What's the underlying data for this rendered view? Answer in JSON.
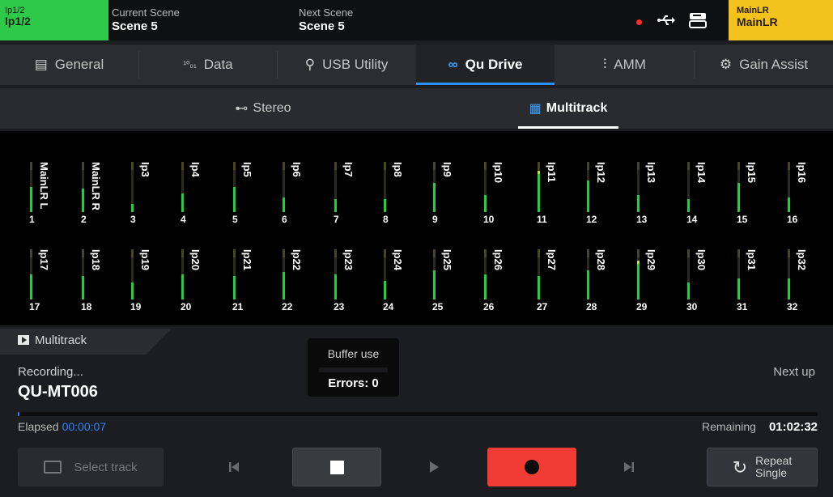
{
  "top": {
    "channel_line1": "Ip1/2",
    "channel_line2": "Ip1/2",
    "current_scene_label": "Current Scene",
    "current_scene_value": "Scene 5",
    "next_scene_label": "Next Scene",
    "next_scene_value": "Scene 5",
    "mix_line1": "MainLR",
    "mix_line2": "MainLR",
    "icons": [
      "record-indicator",
      "usb-icon",
      "drive-icon"
    ]
  },
  "tabs": [
    {
      "label": "General",
      "icon": "▤"
    },
    {
      "label": "Data",
      "icon": "¹⁰₀₁"
    },
    {
      "label": "USB Utility",
      "icon": "⚲"
    },
    {
      "label": "Qu Drive",
      "icon": "∞"
    },
    {
      "label": "AMM",
      "icon": "⫶"
    },
    {
      "label": "Gain Assist",
      "icon": "⚙"
    }
  ],
  "active_tab": "Qu Drive",
  "subtabs": [
    {
      "label": "Stereo",
      "icon": "⊷"
    },
    {
      "label": "Multitrack",
      "icon": "▦"
    }
  ],
  "active_subtab": "Multitrack",
  "channels": [
    {
      "num": "1",
      "name": "MainLR L",
      "level": 0.6
    },
    {
      "num": "2",
      "name": "MainLR R",
      "level": 0.55
    },
    {
      "num": "3",
      "name": "Ip3",
      "level": 0.2
    },
    {
      "num": "4",
      "name": "Ip4",
      "level": 0.45
    },
    {
      "num": "5",
      "name": "Ip5",
      "level": 0.6
    },
    {
      "num": "6",
      "name": "Ip6",
      "level": 0.35
    },
    {
      "num": "7",
      "name": "Ip7",
      "level": 0.3
    },
    {
      "num": "8",
      "name": "Ip8",
      "level": 0.3
    },
    {
      "num": "9",
      "name": "Ip9",
      "level": 0.7
    },
    {
      "num": "10",
      "name": "Ip10",
      "level": 0.4
    },
    {
      "num": "11",
      "name": "Ip11",
      "level": 0.9
    },
    {
      "num": "12",
      "name": "Ip12",
      "level": 0.75
    },
    {
      "num": "13",
      "name": "Ip13",
      "level": 0.4
    },
    {
      "num": "14",
      "name": "Ip14",
      "level": 0.3
    },
    {
      "num": "15",
      "name": "Ip15",
      "level": 0.7
    },
    {
      "num": "16",
      "name": "Ip16",
      "level": 0.35
    },
    {
      "num": "17",
      "name": "Ip17",
      "level": 0.6
    },
    {
      "num": "18",
      "name": "Ip18",
      "level": 0.55
    },
    {
      "num": "19",
      "name": "Ip19",
      "level": 0.4
    },
    {
      "num": "20",
      "name": "Ip20",
      "level": 0.6
    },
    {
      "num": "21",
      "name": "Ip21",
      "level": 0.55
    },
    {
      "num": "22",
      "name": "Ip22",
      "level": 0.65
    },
    {
      "num": "23",
      "name": "Ip23",
      "level": 0.6
    },
    {
      "num": "24",
      "name": "Ip24",
      "level": 0.45
    },
    {
      "num": "25",
      "name": "Ip25",
      "level": 0.7
    },
    {
      "num": "26",
      "name": "Ip26",
      "level": 0.6
    },
    {
      "num": "27",
      "name": "Ip27",
      "level": 0.55
    },
    {
      "num": "28",
      "name": "Ip28",
      "level": 0.7
    },
    {
      "num": "29",
      "name": "Ip29",
      "level": 0.85
    },
    {
      "num": "30",
      "name": "Ip30",
      "level": 0.4
    },
    {
      "num": "31",
      "name": "Ip31",
      "level": 0.5
    },
    {
      "num": "32",
      "name": "Ip32",
      "level": 0.5
    }
  ],
  "player": {
    "section_label": "Multitrack",
    "status": "Recording...",
    "track": "QU-MT006",
    "buffer_label": "Buffer use",
    "errors": "Errors: 0",
    "next_up": "Next up",
    "elapsed_label": "Elapsed",
    "elapsed_value": "00:00:07",
    "remaining_label": "Remaining",
    "remaining_value": "01:02:32",
    "progress": 0.002
  },
  "transport": {
    "select_track": "Select track",
    "repeat_line1": "Repeat",
    "repeat_line2": "Single"
  }
}
